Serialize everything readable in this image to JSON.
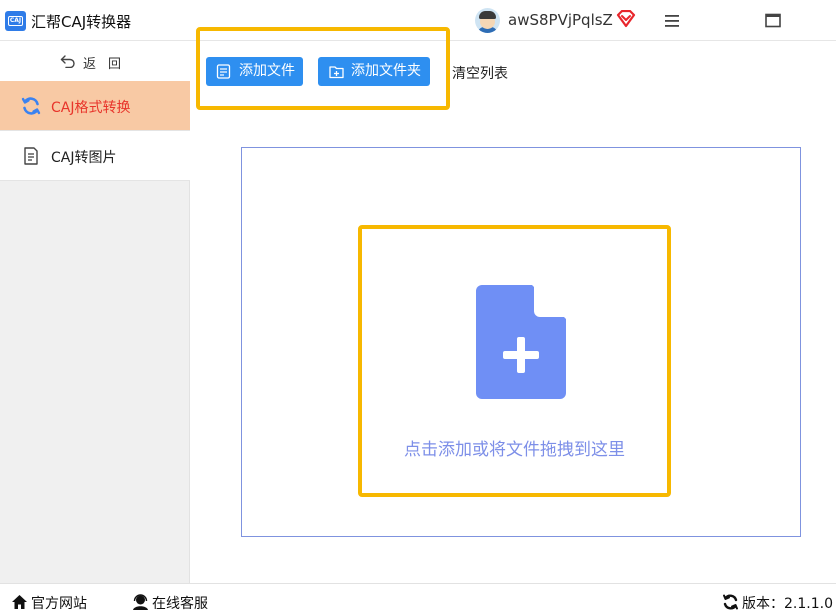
{
  "app": {
    "title": "汇帮CAJ转换器",
    "logo_text": "CAJ",
    "username": "awS8PVjPqlsZ"
  },
  "sidebar": {
    "back_label": "返回",
    "items": [
      {
        "label": "CAJ格式转换",
        "icon": "refresh-icon",
        "active": true
      },
      {
        "label": "CAJ转图片",
        "icon": "document-icon",
        "active": false
      }
    ]
  },
  "toolbar": {
    "add_file_label": "添加文件",
    "add_folder_label": "添加文件夹",
    "clear_list_label": "清空列表"
  },
  "dropzone": {
    "hint": "点击添加或将文件拖拽到这里",
    "icon": "file-plus-icon"
  },
  "footer": {
    "website_label": "官方网站",
    "service_label": "在线客服",
    "version_label": "版本：2.1.1.0"
  },
  "colors": {
    "accent_blue": "#2e8ff0",
    "active_nav_bg": "#f8c9a4",
    "active_nav_text": "#e8352b",
    "highlight_border": "#f7b800",
    "dropzone_border": "#7f93df",
    "file_icon": "#6f8ff5",
    "hint_text": "#7d8fe8"
  }
}
